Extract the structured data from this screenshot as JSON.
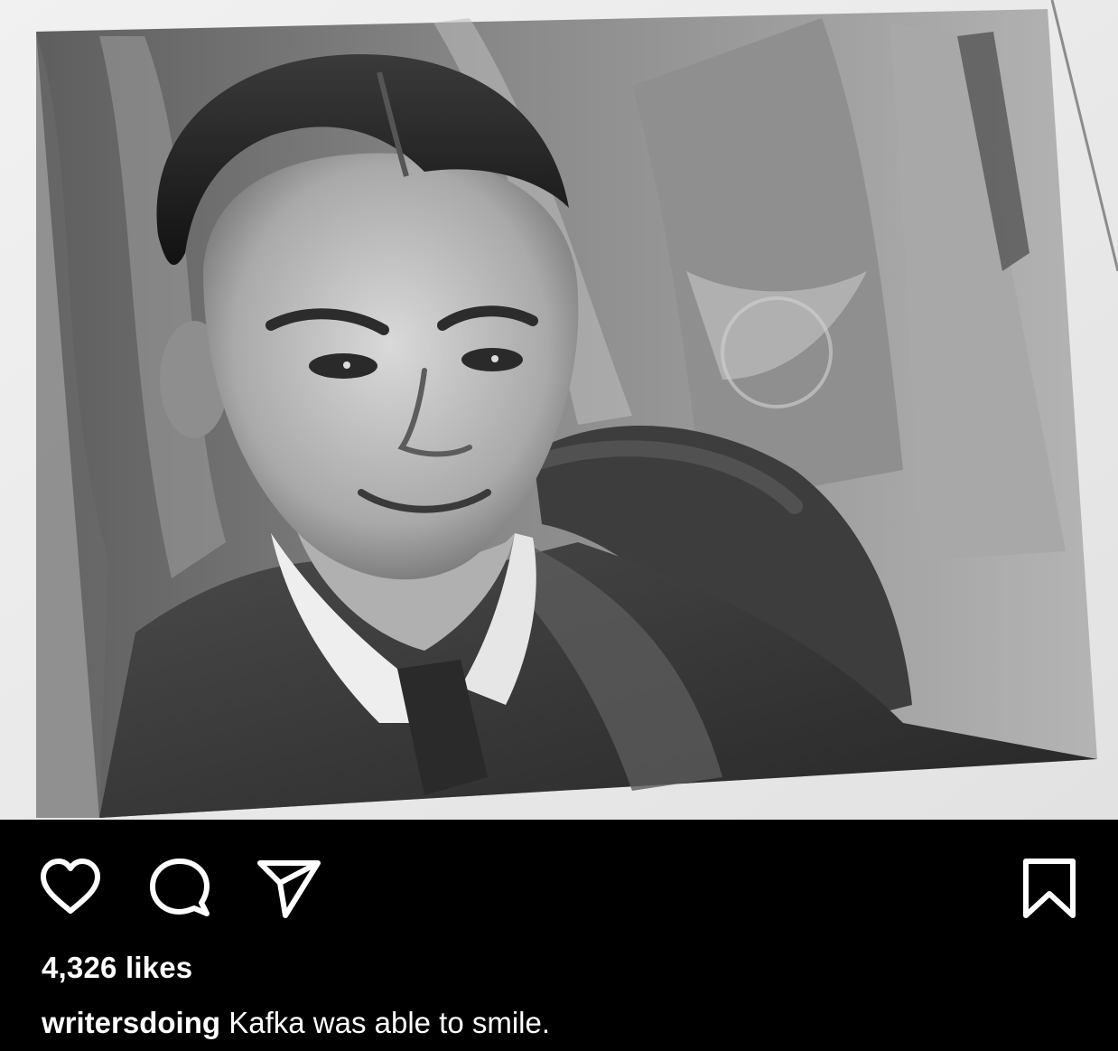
{
  "post": {
    "image_subject": "Kafka was able to smile.",
    "actions": {
      "like_icon": "heart-icon",
      "comment_icon": "comment-bubble-icon",
      "share_icon": "paper-plane-icon",
      "save_icon": "bookmark-icon"
    },
    "likes_text": "4,326 likes",
    "caption": {
      "username": "writersdoing",
      "text": "Kafka was able to smile."
    }
  },
  "colors": {
    "background": "#000000",
    "text": "#ffffff",
    "icon": "#ffffff"
  }
}
